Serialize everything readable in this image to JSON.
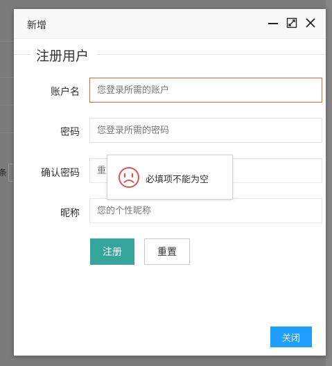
{
  "background": {
    "partial_char": "条"
  },
  "dialog": {
    "title": "新增",
    "header_icons": [
      "minimize-icon",
      "maximize-icon",
      "close-icon"
    ],
    "legend": "注册用户",
    "fields": {
      "account": {
        "label": "账户名",
        "placeholder": "您登录所需的账户",
        "value": ""
      },
      "password": {
        "label": "密码",
        "placeholder": "您登录所需的密码",
        "value": ""
      },
      "confirm": {
        "label": "确认密码",
        "placeholder": "重",
        "value": ""
      },
      "nickname": {
        "label": "昵称",
        "placeholder": "您的个性昵称",
        "value": ""
      }
    },
    "buttons": {
      "register": "注册",
      "reset": "重置",
      "close": "关闭"
    }
  },
  "toast": {
    "icon": "sad-face-icon",
    "message": "必填项不能为空"
  },
  "colors": {
    "error_border": "#e0662e",
    "primary": "#36a69c",
    "close_button": "#1e9fff",
    "toast_icon": "#d9534f"
  }
}
